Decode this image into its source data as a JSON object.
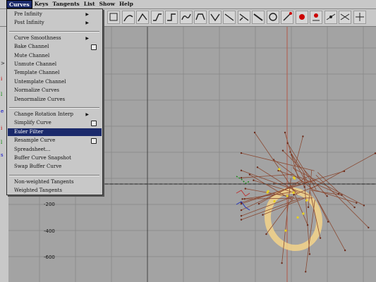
{
  "menubar": [
    "Curves",
    "Keys",
    "Tangents",
    "List",
    "Show",
    "Help"
  ],
  "toolbar_icons": [
    "frame-all-icon",
    "tangent-spline-icon",
    "tangent-linear-icon",
    "tangent-clamped-icon",
    "tangent-step-icon",
    "tangent-flat-icon",
    "tangent-plateau-icon",
    "break-tangents-icon",
    "unify-tangents-icon",
    "free-weight-icon",
    "lock-weight-icon",
    "buffer-swap-icon",
    "snap-icon",
    "key-add-icon",
    "key-remove-icon",
    "insert-key-icon",
    "infinity-pre-icon",
    "infinity-post-icon"
  ],
  "curves_menu": {
    "items": [
      {
        "label": "Pre Infinity",
        "submenu": true
      },
      {
        "label": "Post Infinity",
        "submenu": true
      },
      {
        "sep": true
      },
      {
        "label": "Curve Smoothness",
        "submenu": true
      },
      {
        "label": "Bake Channel",
        "option": true
      },
      {
        "label": "Mute Channel"
      },
      {
        "label": "Unmute Channel"
      },
      {
        "label": "Template Channel"
      },
      {
        "label": "Untemplate Channel"
      },
      {
        "label": "Normalize Curves"
      },
      {
        "label": "Denormalize Curves"
      },
      {
        "sep": true
      },
      {
        "label": "Change Rotation Interp",
        "submenu": true
      },
      {
        "label": "Simplify Curve",
        "option": true
      },
      {
        "label": "Euler Filter",
        "highlighted": true
      },
      {
        "label": "Resample Curve",
        "option": true
      },
      {
        "label": "Spreadsheet..."
      },
      {
        "label": "Buffer Curve Snapshot"
      },
      {
        "label": "Swap Buffer Curve"
      },
      {
        "sep": true
      },
      {
        "label": "Non-weighted Tangents"
      },
      {
        "label": "Weighted Tangents"
      }
    ]
  },
  "graph": {
    "y_labels": [
      "-200",
      "-400",
      "-600"
    ]
  },
  "colors": {
    "menu_highlight": "#1b2a6b",
    "graph_bg": "#a3a3a3",
    "curve": "#8a4a33",
    "circle": "#f5d48a"
  }
}
